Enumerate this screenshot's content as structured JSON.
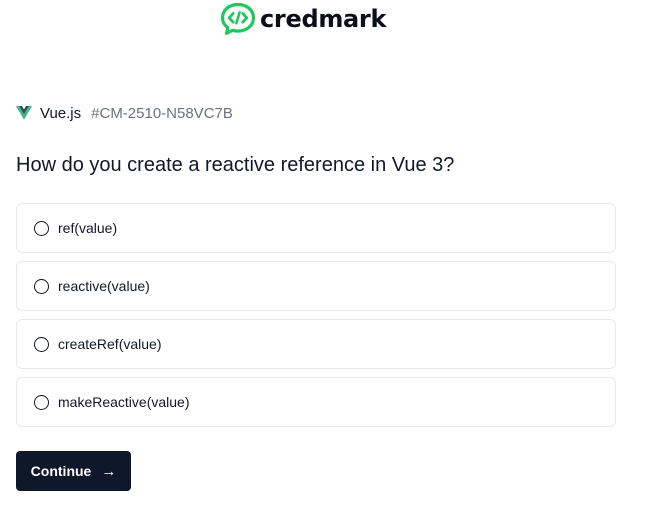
{
  "brand": {
    "name": "credmark",
    "logo_icon": "code-bubble-icon",
    "accent_color": "#22c55e"
  },
  "topic": {
    "name": "Vue.js",
    "code": "#CM-2510-N58VC7B",
    "icon": "vue-icon",
    "icon_color": "#41b883"
  },
  "question": {
    "text": "How do you create a reactive reference in Vue 3?"
  },
  "options": [
    {
      "label": "ref(value)",
      "selected": false
    },
    {
      "label": "reactive(value)",
      "selected": false
    },
    {
      "label": "createRef(value)",
      "selected": false
    },
    {
      "label": "makeReactive(value)",
      "selected": false
    }
  ],
  "actions": {
    "continue_label": "Continue",
    "continue_icon": "arrow-right-icon",
    "button_color": "#0f172a"
  }
}
